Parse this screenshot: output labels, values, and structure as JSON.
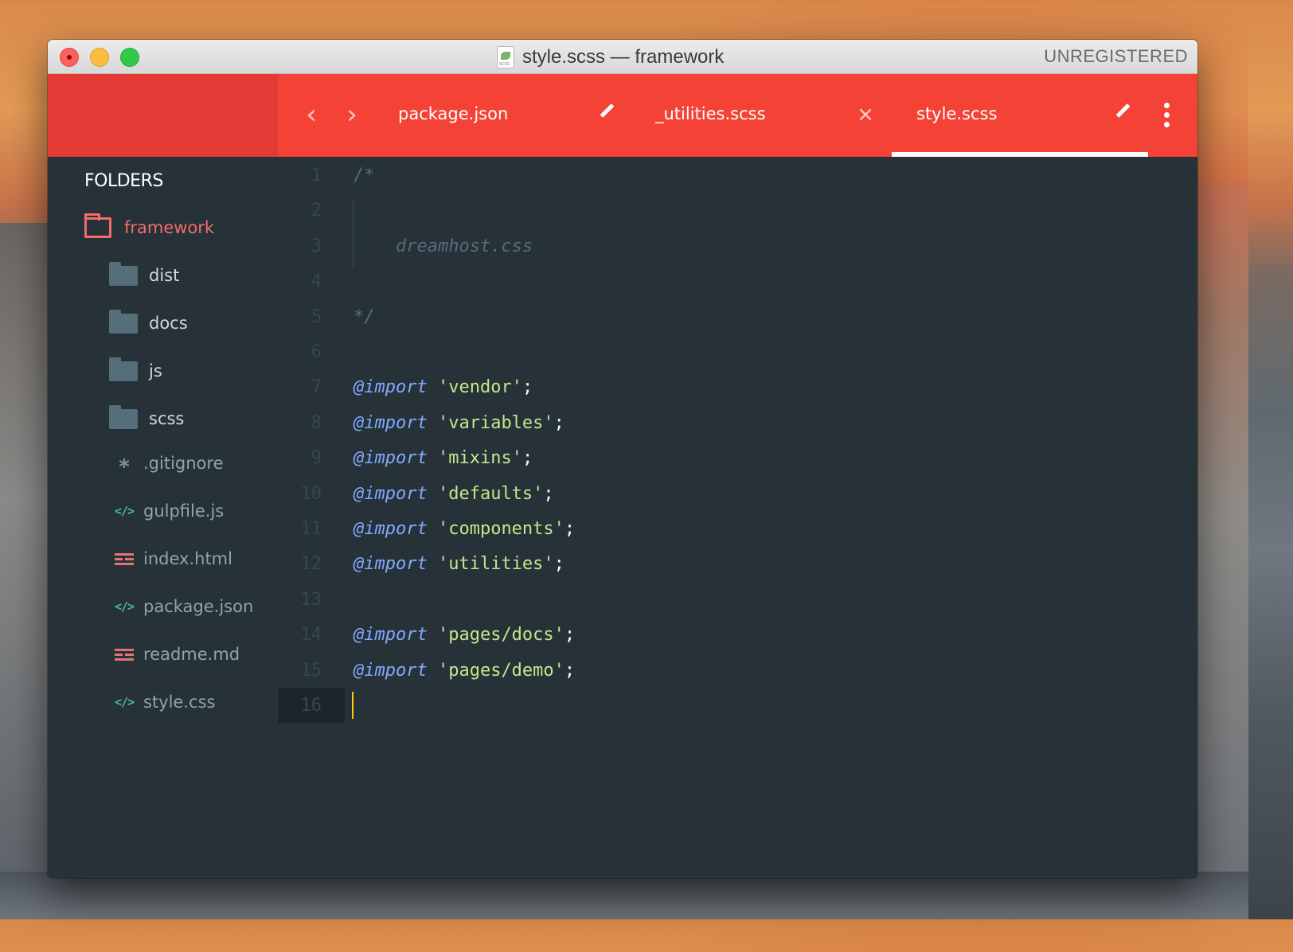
{
  "window": {
    "title": "style.scss — framework",
    "status": "UNREGISTERED"
  },
  "tabs": [
    {
      "label": "package.json",
      "action": "edit"
    },
    {
      "label": "_utilities.scss",
      "action": "close"
    },
    {
      "label": "style.scss",
      "action": "edit",
      "active": true
    }
  ],
  "colors": {
    "accent": "#f44336",
    "sidebar_bg": "#263238",
    "folder_highlight": "#f26d6b",
    "caret": "#ffcc00"
  },
  "sidebar": {
    "heading": "FOLDERS",
    "root": {
      "label": "framework",
      "icon": "folder-open-icon"
    },
    "folders": [
      {
        "label": "dist",
        "icon": "folder-icon"
      },
      {
        "label": "docs",
        "icon": "folder-icon"
      },
      {
        "label": "js",
        "icon": "folder-icon"
      },
      {
        "label": "scss",
        "icon": "folder-icon"
      }
    ],
    "files": [
      {
        "label": ".gitignore",
        "icon": "asterisk-icon"
      },
      {
        "label": "gulpfile.js",
        "icon": "code-icon"
      },
      {
        "label": "index.html",
        "icon": "html-icon"
      },
      {
        "label": "package.json",
        "icon": "code-icon"
      },
      {
        "label": "readme.md",
        "icon": "html-icon"
      },
      {
        "label": "style.css",
        "icon": "code-icon"
      }
    ]
  },
  "editor": {
    "active_line": 16,
    "lines": [
      {
        "n": "1",
        "tokens": [
          {
            "t": "cm",
            "v": "/*"
          }
        ]
      },
      {
        "n": "2",
        "tokens": []
      },
      {
        "n": "3",
        "tokens": [
          {
            "t": "cm",
            "v": "    dreamhost.css"
          }
        ]
      },
      {
        "n": "4",
        "tokens": []
      },
      {
        "n": "5",
        "tokens": [
          {
            "t": "cm",
            "v": "*/"
          }
        ]
      },
      {
        "n": "6",
        "tokens": []
      },
      {
        "n": "7",
        "tokens": [
          {
            "t": "kw",
            "v": "@import"
          },
          {
            "t": "pun",
            "v": " "
          },
          {
            "t": "str",
            "v": "'vendor'"
          },
          {
            "t": "pun",
            "v": ";"
          }
        ]
      },
      {
        "n": "8",
        "tokens": [
          {
            "t": "kw",
            "v": "@import"
          },
          {
            "t": "pun",
            "v": " "
          },
          {
            "t": "str",
            "v": "'variables'"
          },
          {
            "t": "pun",
            "v": ";"
          }
        ]
      },
      {
        "n": "9",
        "tokens": [
          {
            "t": "kw",
            "v": "@import"
          },
          {
            "t": "pun",
            "v": " "
          },
          {
            "t": "str",
            "v": "'mixins'"
          },
          {
            "t": "pun",
            "v": ";"
          }
        ]
      },
      {
        "n": "10",
        "tokens": [
          {
            "t": "kw",
            "v": "@import"
          },
          {
            "t": "pun",
            "v": " "
          },
          {
            "t": "str",
            "v": "'defaults'"
          },
          {
            "t": "pun",
            "v": ";"
          }
        ]
      },
      {
        "n": "11",
        "tokens": [
          {
            "t": "kw",
            "v": "@import"
          },
          {
            "t": "pun",
            "v": " "
          },
          {
            "t": "str",
            "v": "'components'"
          },
          {
            "t": "pun",
            "v": ";"
          }
        ]
      },
      {
        "n": "12",
        "tokens": [
          {
            "t": "kw",
            "v": "@import"
          },
          {
            "t": "pun",
            "v": " "
          },
          {
            "t": "str",
            "v": "'utilities'"
          },
          {
            "t": "pun",
            "v": ";"
          }
        ]
      },
      {
        "n": "13",
        "tokens": []
      },
      {
        "n": "14",
        "tokens": [
          {
            "t": "kw",
            "v": "@import"
          },
          {
            "t": "pun",
            "v": " "
          },
          {
            "t": "str",
            "v": "'pages/docs'"
          },
          {
            "t": "pun",
            "v": ";"
          }
        ]
      },
      {
        "n": "15",
        "tokens": [
          {
            "t": "kw",
            "v": "@import"
          },
          {
            "t": "pun",
            "v": " "
          },
          {
            "t": "str",
            "v": "'pages/demo'"
          },
          {
            "t": "pun",
            "v": ";"
          }
        ]
      },
      {
        "n": "16",
        "tokens": []
      }
    ]
  }
}
